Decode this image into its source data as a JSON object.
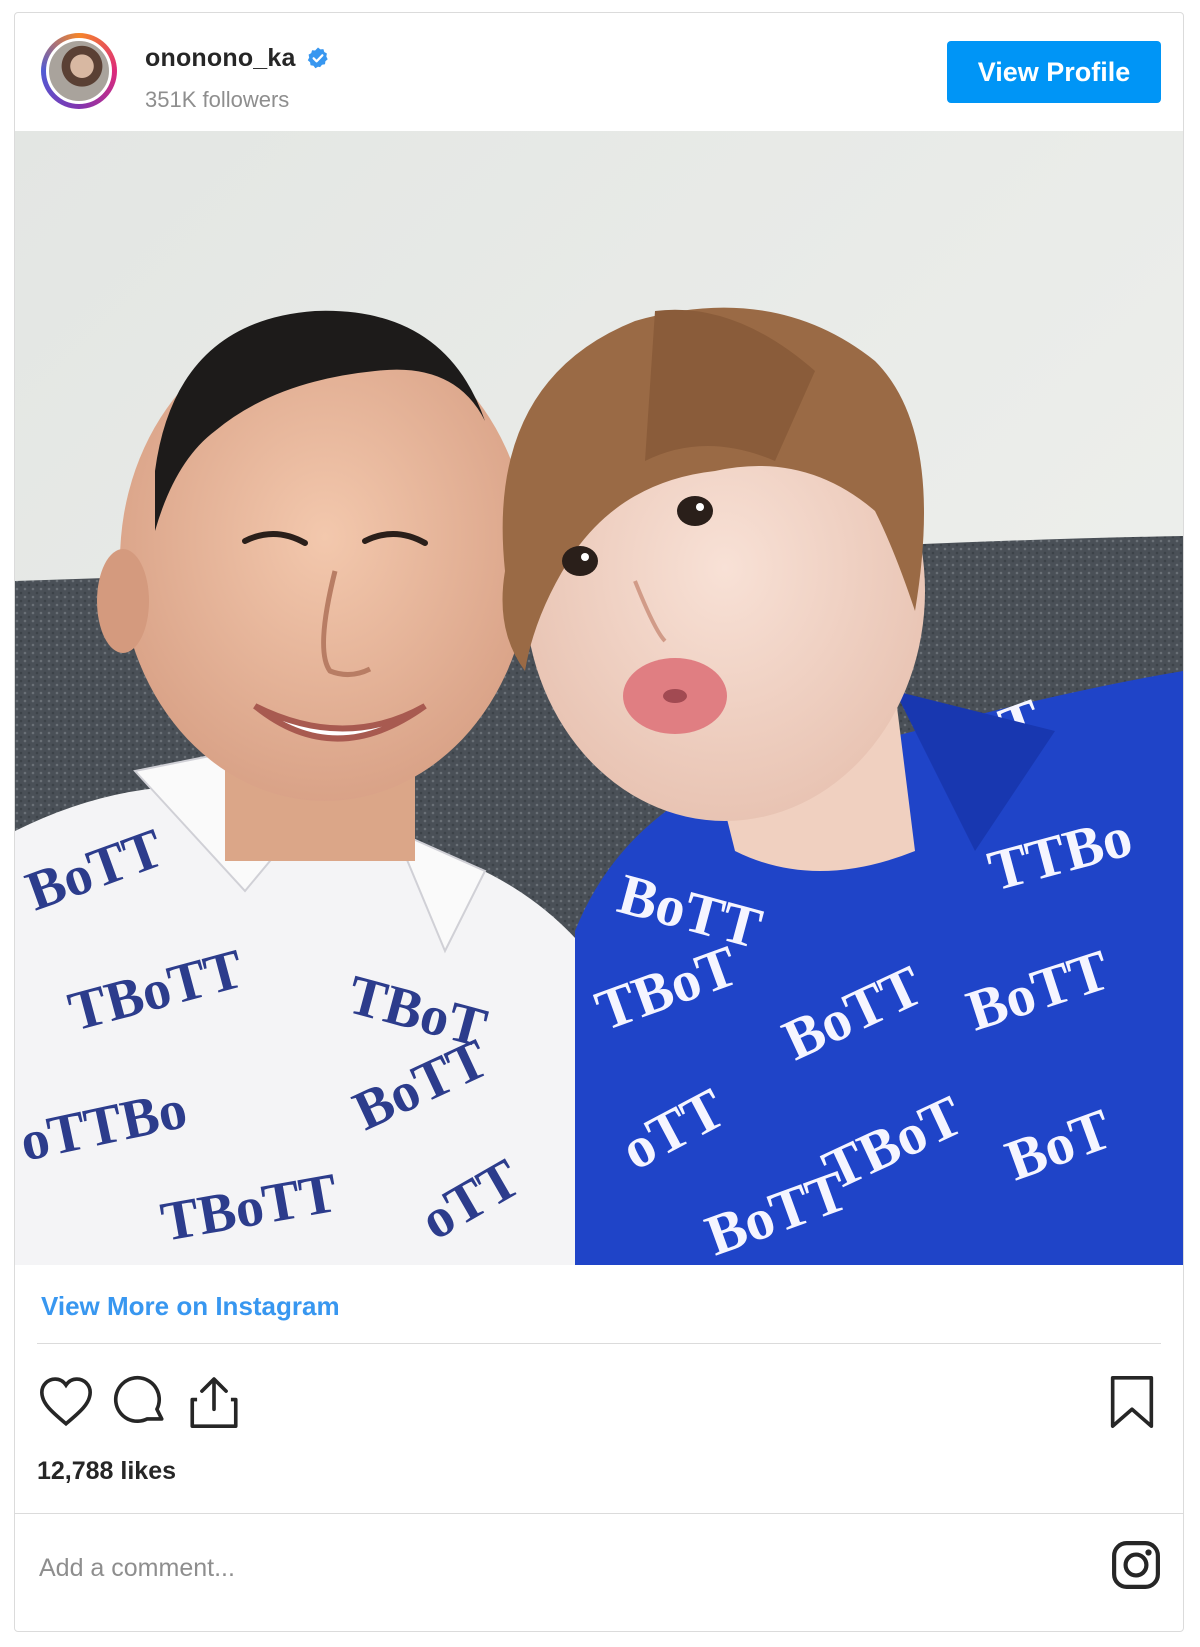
{
  "post": {
    "username": "ononono_ka",
    "followers": "351K followers",
    "view_profile_label": "View Profile",
    "view_more_label": "View More on Instagram",
    "likes": "12,788 likes",
    "comment_placeholder": "Add a comment..."
  },
  "icons": {
    "verified": "verified-badge-icon",
    "like": "heart-icon",
    "comment": "comment-bubble-icon",
    "share": "share-icon",
    "save": "bookmark-icon",
    "brand": "instagram-icon"
  },
  "colors": {
    "accent": "#0095f6",
    "link": "#3897f0",
    "verified": "#3897f0",
    "text": "#262626",
    "muted": "#8e8e8e"
  }
}
